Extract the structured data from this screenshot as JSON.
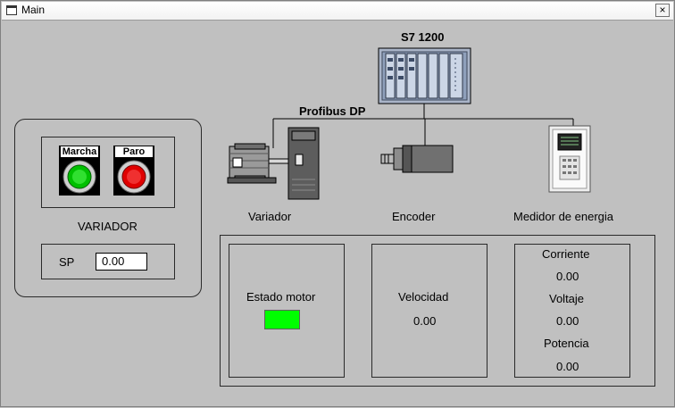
{
  "window": {
    "title": "Main",
    "close_symbol": "×"
  },
  "plc": {
    "label": "S7 1200",
    "bus_label": "Profibus DP",
    "icon": "plc-rack-icon"
  },
  "devices": {
    "variador": {
      "label": "Variador",
      "icon": "motor-drive-icon"
    },
    "encoder": {
      "label": "Encoder",
      "icon": "encoder-icon"
    },
    "medidor": {
      "label": "Medidor de energia",
      "icon": "energy-meter-icon"
    }
  },
  "control_panel": {
    "marcha_label": "Marcha",
    "paro_label": "Paro",
    "marcha_color": "#00c000",
    "paro_color": "#e00000",
    "variador_label": "VARIADOR",
    "sp_label": "SP",
    "sp_value": "0.00"
  },
  "status": {
    "estado_motor_label": "Estado motor",
    "estado_motor_color": "#00ff00",
    "velocidad_label": "Velocidad",
    "velocidad_value": "0.00",
    "corriente_label": "Corriente",
    "corriente_value": "0.00",
    "voltaje_label": "Voltaje",
    "voltaje_value": "0.00",
    "potencia_label": "Potencia",
    "potencia_value": "0.00"
  }
}
